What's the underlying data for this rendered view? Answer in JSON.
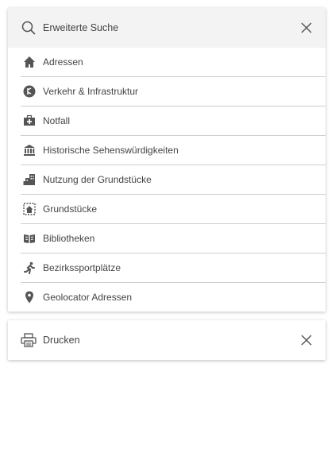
{
  "search": {
    "title": "Erweiterte Suche",
    "icon": "search-icon",
    "close_icon": "close-icon"
  },
  "menu": {
    "items": [
      {
        "label": "Adressen",
        "icon": "home-icon"
      },
      {
        "label": "Verkehr & Infrastruktur",
        "icon": "traffic-icon"
      },
      {
        "label": "Notfall",
        "icon": "first-aid-icon"
      },
      {
        "label": "Historische Sehenswürdigkeiten",
        "icon": "monument-icon"
      },
      {
        "label": "Nutzung der Grundstücke",
        "icon": "city-icon"
      },
      {
        "label": "Grundstücke",
        "icon": "property-icon"
      },
      {
        "label": "Bibliotheken",
        "icon": "book-icon"
      },
      {
        "label": "Bezirkssportplätze",
        "icon": "runner-icon"
      },
      {
        "label": "Geolocator Adressen",
        "icon": "location-pin-icon"
      }
    ]
  },
  "print": {
    "title": "Drucken",
    "icon": "printer-icon",
    "close_icon": "close-icon"
  },
  "colors": {
    "header_bg": "#f3f3f3",
    "icon": "#555555",
    "divider": "#cfcfcf"
  }
}
